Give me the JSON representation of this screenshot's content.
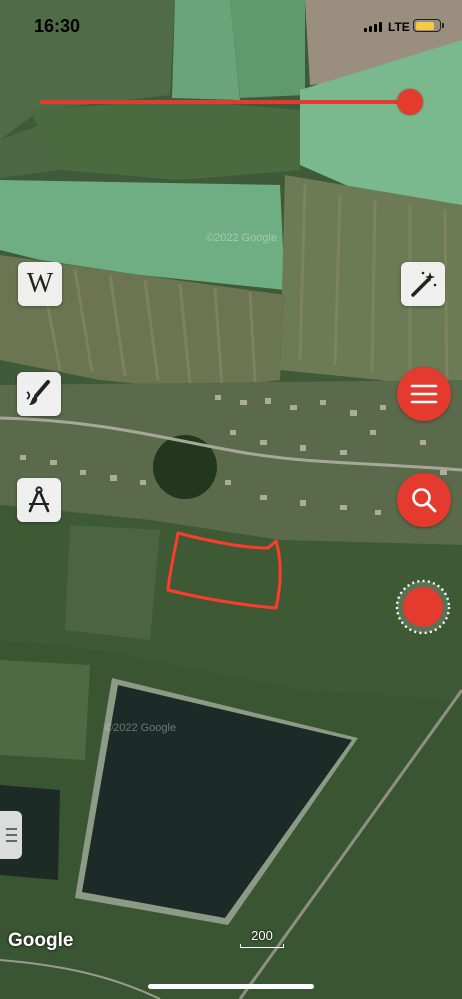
{
  "status_bar": {
    "time": "16:30",
    "network": "LTE",
    "battery_level": 0.85
  },
  "slider": {
    "value": 1.0
  },
  "toolbar_left": {
    "wiki_glyph": "W"
  },
  "watermarks": [
    "©2022 Google",
    "©2022 Google"
  ],
  "attribution": "Google",
  "scale": {
    "label": "200"
  },
  "colors": {
    "accent": "#e53b2f",
    "button_bg": "#f5f5f5",
    "drawn_outline": "#ff3b2e"
  },
  "icons": [
    "magic-wand-icon",
    "wikipedia-icon",
    "paintbrush-icon",
    "compass-icon",
    "menu-icon",
    "search-icon",
    "record-icon",
    "drawer-handle-icon"
  ]
}
